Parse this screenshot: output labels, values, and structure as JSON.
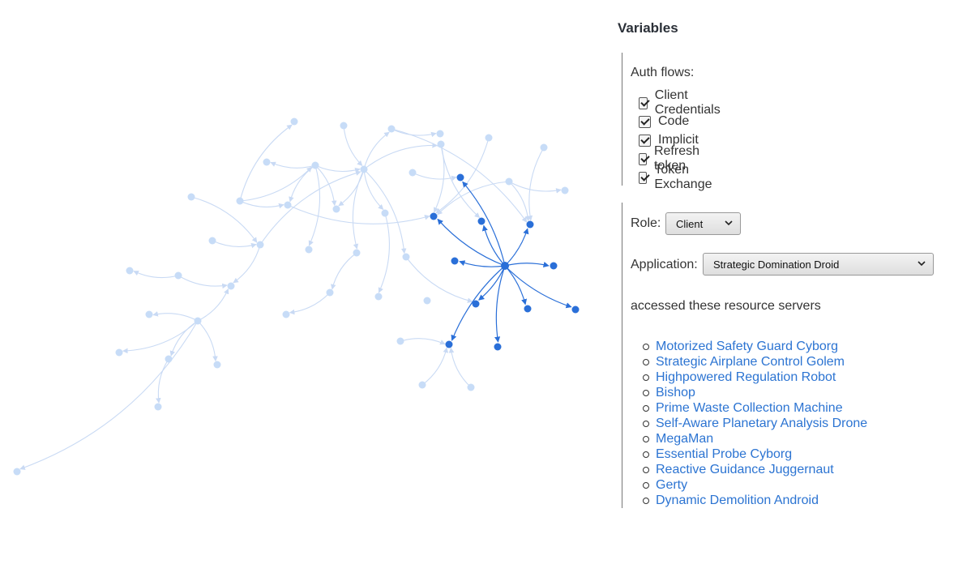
{
  "panel": {
    "title": "Variables",
    "auth_flows_label": "Auth flows:",
    "auth_flows": [
      {
        "label": "Client Credentials",
        "checked": true
      },
      {
        "label": "Code",
        "checked": true
      },
      {
        "label": "Implicit",
        "checked": true
      },
      {
        "label": "Refresh token",
        "checked": true
      },
      {
        "label": "Token Exchange",
        "checked": true
      }
    ],
    "role_label": "Role:",
    "role_value": "Client",
    "application_label": "Application:",
    "application_value": "Strategic Domination Droid",
    "accessed_text": "accessed these resource servers",
    "resource_servers": [
      "Motorized Safety Guard Cyborg",
      "Strategic Airplane Control Golem",
      "Highpowered Regulation Robot",
      "Bishop",
      "Prime Waste Collection Machine",
      "Self-Aware Planetary Analysis Drone",
      "MegaMan",
      "Essential Probe Cyborg",
      "Reactive Guidance Juggernaut",
      "Gerty",
      "Dynamic Demolition Android"
    ]
  },
  "colors": {
    "highlight": "#2a6fd8",
    "faded_node": "#c7dcf7",
    "faded_edge": "#c9daf4",
    "link": "#2c74d2"
  }
}
